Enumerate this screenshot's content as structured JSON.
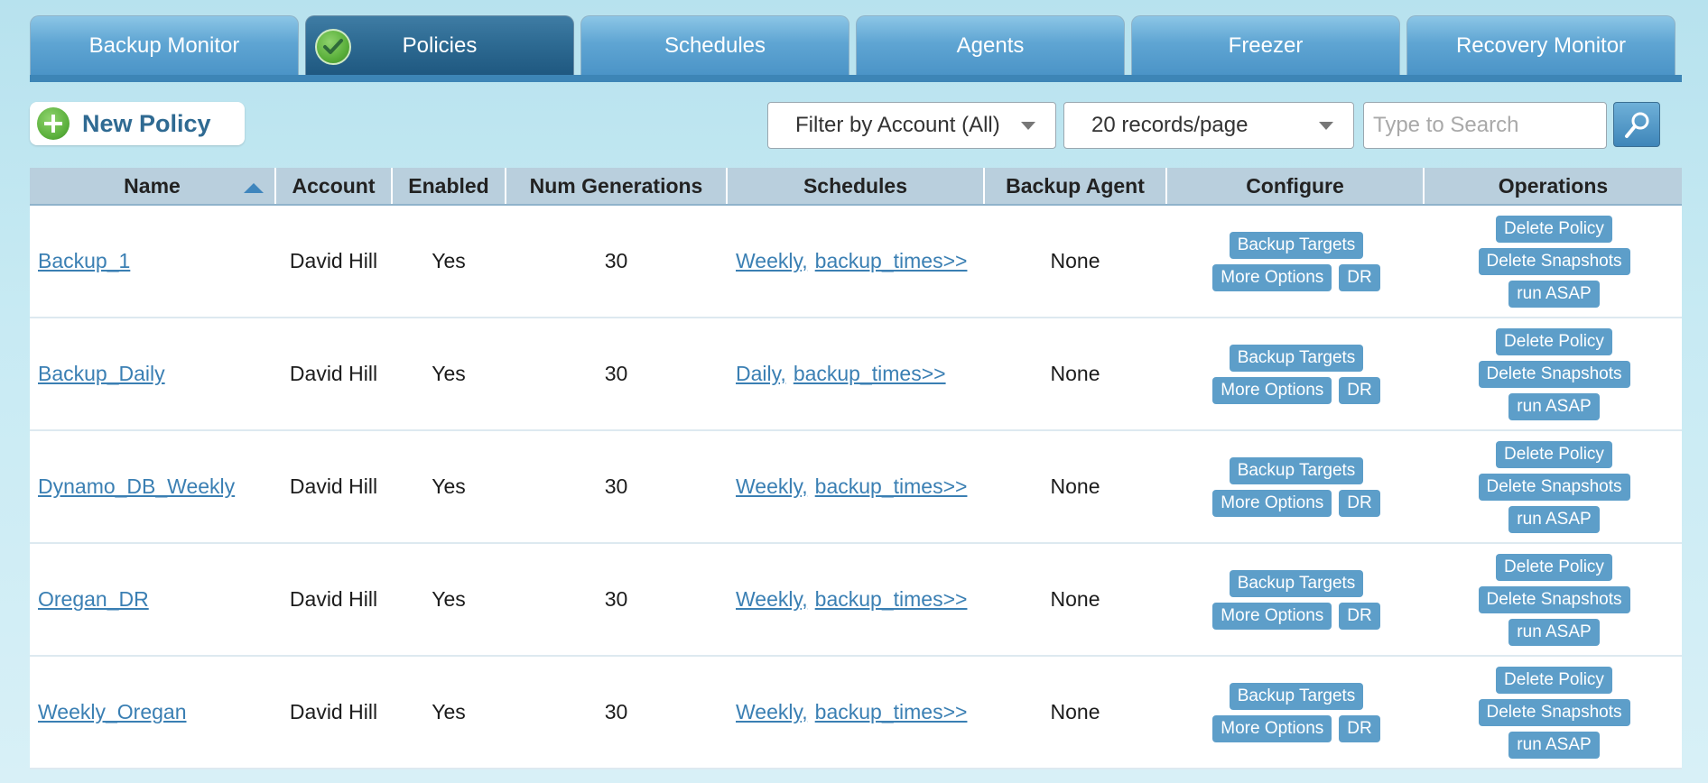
{
  "tabs": [
    {
      "label": "Backup Monitor",
      "active": false
    },
    {
      "label": "Policies",
      "active": true
    },
    {
      "label": "Schedules",
      "active": false
    },
    {
      "label": "Agents",
      "active": false
    },
    {
      "label": "Freezer",
      "active": false
    },
    {
      "label": "Recovery Monitor",
      "active": false
    }
  ],
  "toolbar": {
    "new_policy_label": "New Policy",
    "filter_label": "Filter by Account (All)",
    "page_size_label": "20 records/page",
    "search_placeholder": "Type to Search"
  },
  "table": {
    "columns": [
      "Name",
      "Account",
      "Enabled",
      "Num Generations",
      "Schedules",
      "Backup Agent",
      "Configure",
      "Operations"
    ],
    "sort": {
      "column": "Name",
      "direction": "asc"
    },
    "configure_buttons": {
      "targets": "Backup Targets",
      "more": "More Options",
      "dr": "DR"
    },
    "operation_buttons": {
      "delete_policy": "Delete Policy",
      "delete_snapshots": "Delete Snapshots",
      "run_asap": "run ASAP"
    },
    "rows": [
      {
        "name": "Backup_1",
        "account": "David Hill",
        "enabled": "Yes",
        "generations": "30",
        "schedule": "Weekly,",
        "times": "backup_times>>",
        "agent": "None"
      },
      {
        "name": "Backup_Daily",
        "account": "David Hill",
        "enabled": "Yes",
        "generations": "30",
        "schedule": "Daily,",
        "times": "backup_times>>",
        "agent": "None"
      },
      {
        "name": "Dynamo_DB_Weekly",
        "account": "David Hill",
        "enabled": "Yes",
        "generations": "30",
        "schedule": "Weekly,",
        "times": "backup_times>>",
        "agent": "None"
      },
      {
        "name": "Oregan_DR",
        "account": "David Hill",
        "enabled": "Yes",
        "generations": "30",
        "schedule": "Weekly,",
        "times": "backup_times>>",
        "agent": "None"
      },
      {
        "name": "Weekly_Oregan",
        "account": "David Hill",
        "enabled": "Yes",
        "generations": "30",
        "schedule": "Weekly,",
        "times": "backup_times>>",
        "agent": "None"
      }
    ]
  },
  "colors": {
    "accent": "#3d85b6",
    "link": "#3a7fb3",
    "button": "#5d9ec9",
    "header": "#b9cfdd"
  },
  "icons": {
    "active_tab": "check-icon",
    "new_policy": "plus-icon",
    "search": "search-icon",
    "sort": "sort-asc-icon",
    "dropdown": "chevron-down-icon"
  }
}
